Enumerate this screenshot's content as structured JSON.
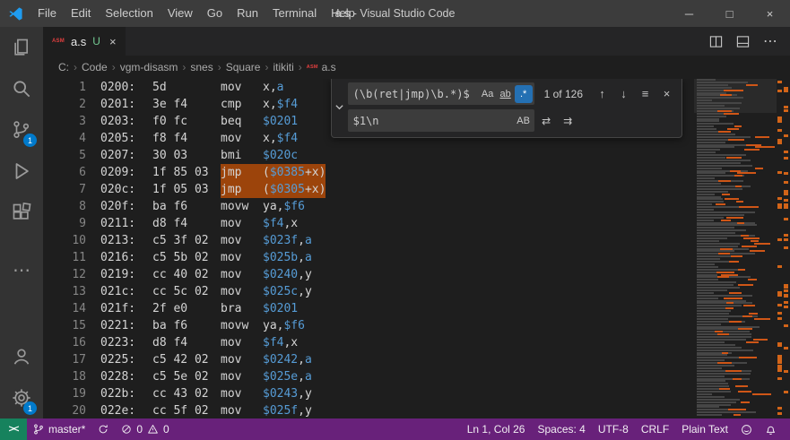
{
  "title_bar": {
    "menus": [
      "File",
      "Edit",
      "Selection",
      "View",
      "Go",
      "Run",
      "Terminal",
      "Help"
    ],
    "title": "a.s - Visual Studio Code"
  },
  "icons": {
    "minimize": "─",
    "maximize": "□",
    "close": "×",
    "more_actions": "⋯",
    "activity_more": "⋯",
    "tab_close": "×",
    "asm_badge": "ASM",
    "match_case": "Aa",
    "whole_word": "ab",
    "regex": ".*",
    "prev_match": "↑",
    "next_match": "↓",
    "find_in_selection": "≡",
    "close_find": "×",
    "preserve_case": "AB",
    "replace": "⇄",
    "replace_all": "⇉",
    "remote": "><"
  },
  "tab": {
    "label": "a.s",
    "git_status": "U"
  },
  "tab_actions": {
    "scm_badge": "1",
    "settings_badge": "1"
  },
  "breadcrumb": {
    "items": [
      "C:",
      "Code",
      "vgm-disasm",
      "snes",
      "Square",
      "itikiti",
      "a.s"
    ]
  },
  "find": {
    "search_value": "(\\b(ret|jmp)\\b.*)$",
    "results": "1 of 126",
    "replace_value": "$1\\n"
  },
  "editor": {
    "lines": [
      {
        "n": "1",
        "addr": "0200:",
        "b": "5d",
        "mn": "mov",
        "op": [
          {
            "t": "x,",
            "c": "p"
          },
          {
            "t": "a",
            "c": "n"
          }
        ],
        "m": false
      },
      {
        "n": "2",
        "addr": "0201:",
        "b": "3e f4",
        "mn": "cmp",
        "op": [
          {
            "t": "x,",
            "c": "p"
          },
          {
            "t": "$f4",
            "c": "n"
          }
        ],
        "m": false
      },
      {
        "n": "3",
        "addr": "0203:",
        "b": "f0 fc",
        "mn": "beq",
        "op": [
          {
            "t": "$0201",
            "c": "n"
          }
        ],
        "m": false
      },
      {
        "n": "4",
        "addr": "0205:",
        "b": "f8 f4",
        "mn": "mov",
        "op": [
          {
            "t": "x,",
            "c": "p"
          },
          {
            "t": "$f4",
            "c": "n"
          }
        ],
        "m": false
      },
      {
        "n": "5",
        "addr": "0207:",
        "b": "30 03",
        "mn": "bmi",
        "op": [
          {
            "t": "$020c",
            "c": "n"
          }
        ],
        "m": false
      },
      {
        "n": "6",
        "addr": "0209:",
        "b": "1f 85 03",
        "mn": "jmp",
        "op": [
          {
            "t": "(",
            "c": "p"
          },
          {
            "t": "$0385",
            "c": "n"
          },
          {
            "t": "+x)",
            "c": "p"
          }
        ],
        "m": true
      },
      {
        "n": "7",
        "addr": "020c:",
        "b": "1f 05 03",
        "mn": "jmp",
        "op": [
          {
            "t": "(",
            "c": "p"
          },
          {
            "t": "$0305",
            "c": "n"
          },
          {
            "t": "+x)",
            "c": "p"
          }
        ],
        "m": true
      },
      {
        "n": "8",
        "addr": "020f:",
        "b": "ba f6",
        "mn": "movw",
        "op": [
          {
            "t": "ya,",
            "c": "p"
          },
          {
            "t": "$f6",
            "c": "n"
          }
        ],
        "m": false
      },
      {
        "n": "9",
        "addr": "0211:",
        "b": "d8 f4",
        "mn": "mov",
        "op": [
          {
            "t": "$f4",
            "c": "n"
          },
          {
            "t": ",x",
            "c": "p"
          }
        ],
        "m": false
      },
      {
        "n": "10",
        "addr": "0213:",
        "b": "c5 3f 02",
        "mn": "mov",
        "op": [
          {
            "t": "$023f",
            "c": "n"
          },
          {
            "t": ",",
            "c": "p"
          },
          {
            "t": "a",
            "c": "n"
          }
        ],
        "m": false
      },
      {
        "n": "11",
        "addr": "0216:",
        "b": "c5 5b 02",
        "mn": "mov",
        "op": [
          {
            "t": "$025b",
            "c": "n"
          },
          {
            "t": ",",
            "c": "p"
          },
          {
            "t": "a",
            "c": "n"
          }
        ],
        "m": false
      },
      {
        "n": "12",
        "addr": "0219:",
        "b": "cc 40 02",
        "mn": "mov",
        "op": [
          {
            "t": "$0240",
            "c": "n"
          },
          {
            "t": ",y",
            "c": "p"
          }
        ],
        "m": false
      },
      {
        "n": "13",
        "addr": "021c:",
        "b": "cc 5c 02",
        "mn": "mov",
        "op": [
          {
            "t": "$025c",
            "c": "n"
          },
          {
            "t": ",y",
            "c": "p"
          }
        ],
        "m": false
      },
      {
        "n": "14",
        "addr": "021f:",
        "b": "2f e0",
        "mn": "bra",
        "op": [
          {
            "t": "$0201",
            "c": "n"
          }
        ],
        "m": false
      },
      {
        "n": "15",
        "addr": "0221:",
        "b": "ba f6",
        "mn": "movw",
        "op": [
          {
            "t": "ya,",
            "c": "p"
          },
          {
            "t": "$f6",
            "c": "n"
          }
        ],
        "m": false
      },
      {
        "n": "16",
        "addr": "0223:",
        "b": "d8 f4",
        "mn": "mov",
        "op": [
          {
            "t": "$f4",
            "c": "n"
          },
          {
            "t": ",x",
            "c": "p"
          }
        ],
        "m": false
      },
      {
        "n": "17",
        "addr": "0225:",
        "b": "c5 42 02",
        "mn": "mov",
        "op": [
          {
            "t": "$0242",
            "c": "n"
          },
          {
            "t": ",",
            "c": "p"
          },
          {
            "t": "a",
            "c": "n"
          }
        ],
        "m": false
      },
      {
        "n": "18",
        "addr": "0228:",
        "b": "c5 5e 02",
        "mn": "mov",
        "op": [
          {
            "t": "$025e",
            "c": "n"
          },
          {
            "t": ",",
            "c": "p"
          },
          {
            "t": "a",
            "c": "n"
          }
        ],
        "m": false
      },
      {
        "n": "19",
        "addr": "022b:",
        "b": "cc 43 02",
        "mn": "mov",
        "op": [
          {
            "t": "$0243",
            "c": "n"
          },
          {
            "t": ",y",
            "c": "p"
          }
        ],
        "m": false
      },
      {
        "n": "20",
        "addr": "022e:",
        "b": "cc 5f 02",
        "mn": "mov",
        "op": [
          {
            "t": "$025f",
            "c": "n"
          },
          {
            "t": ",y",
            "c": "p"
          }
        ],
        "m": false
      }
    ]
  },
  "status_bar": {
    "branch": "master*",
    "errors": "0",
    "warnings": "0",
    "line_col": "Ln 1, Col 26",
    "indentation": "Spaces: 4",
    "encoding": "UTF-8",
    "eol": "CRLF",
    "language": "Plain Text"
  },
  "colors": {
    "status_bar": "#68217a",
    "remote_indicator": "#16825d",
    "accent_badge": "#007acc",
    "find_match_highlight": "#ea5c00",
    "git_untracked": "#73c991",
    "number_token": "#569cd6"
  }
}
